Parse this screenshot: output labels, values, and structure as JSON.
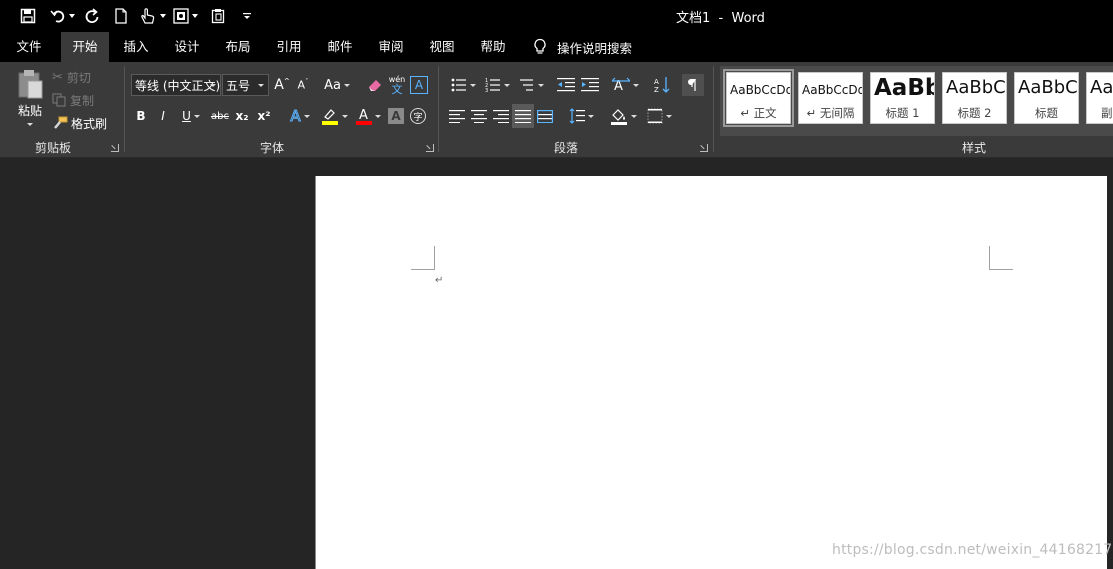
{
  "window": {
    "doc_title": "文档1  -  Word"
  },
  "qat": {
    "icons": [
      "save-icon",
      "undo-icon",
      "redo-icon",
      "new-document-icon",
      "touch-mode-icon",
      "print-preview-icon",
      "paste-icon",
      "customize-qat-icon"
    ]
  },
  "tabs": [
    {
      "label": "文件"
    },
    {
      "label": "开始"
    },
    {
      "label": "插入"
    },
    {
      "label": "设计"
    },
    {
      "label": "布局"
    },
    {
      "label": "引用"
    },
    {
      "label": "邮件"
    },
    {
      "label": "审阅"
    },
    {
      "label": "视图"
    },
    {
      "label": "帮助"
    }
  ],
  "active_tab": "开始",
  "tell_me": {
    "label": "操作说明搜索"
  },
  "ribbon": {
    "clipboard": {
      "group_label": "剪贴板",
      "paste": "粘贴",
      "cut": "剪切",
      "copy": "复制",
      "format_painter": "格式刷"
    },
    "font": {
      "group_label": "字体",
      "font_name": "等线 (中文正文)",
      "font_size": "五号",
      "change_case": "Aa",
      "phonetic_top": "wén",
      "phonetic_bottom": "文",
      "bold": "B",
      "italic": "I",
      "underline": "U",
      "strike": "abc",
      "subscript": "x₂",
      "superscript": "x²",
      "char_border": "A",
      "char_shading": "A",
      "enclose": "字",
      "highlight_color": "#ffff00",
      "font_color": "#ff0000"
    },
    "paragraph": {
      "group_label": "段落"
    },
    "styles": {
      "group_label": "样式",
      "items": [
        {
          "sample": "AaBbCcDd",
          "name": "↵ 正文"
        },
        {
          "sample": "AaBbCcDd",
          "name": "↵ 无间隔"
        },
        {
          "sample": "AaBb",
          "name": "标题 1"
        },
        {
          "sample": "AaBbC",
          "name": "标题 2"
        },
        {
          "sample": "AaBbC",
          "name": "标题"
        },
        {
          "sample": "Aa",
          "name": "副"
        }
      ]
    }
  },
  "document": {
    "paragraph_mark": "↵"
  },
  "watermark": "https://blog.csdn.net/weixin_44168217",
  "colors": {
    "background": "#252525",
    "titlebar": "#000000",
    "ribbon": "#3a3a3a",
    "page": "#ffffff"
  }
}
